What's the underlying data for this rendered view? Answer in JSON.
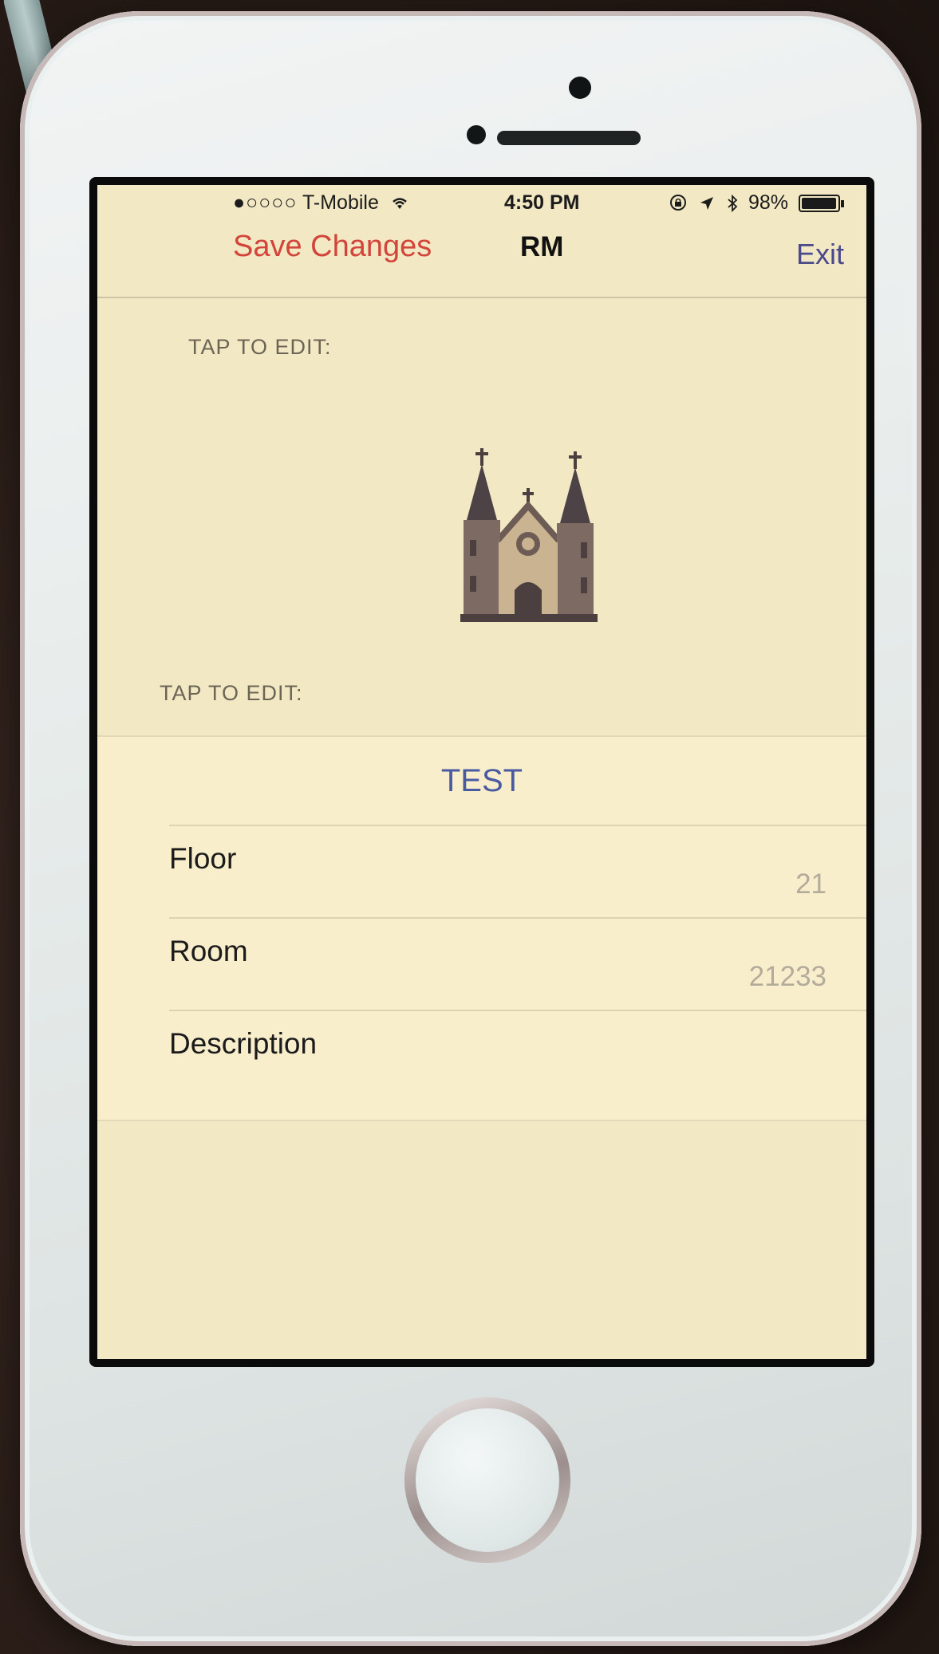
{
  "status_bar": {
    "signal": "●○○○○",
    "carrier": "T-Mobile",
    "time": "4:50 PM",
    "battery": "98%"
  },
  "nav": {
    "save_label": "Save Changes",
    "title": "RM",
    "exit_label": "Exit"
  },
  "image_section": {
    "label": "TAP TO EDIT:",
    "icon": "church-icon"
  },
  "details_section": {
    "label": "TAP TO EDIT:",
    "name": "TEST",
    "rows": [
      {
        "label": "Floor",
        "value": "21"
      },
      {
        "label": "Room",
        "value": "21233"
      },
      {
        "label": "Description",
        "value": ""
      }
    ]
  },
  "colors": {
    "save_accent": "#d2453a",
    "link_accent": "#4a5aa0",
    "screen_background": "#f3e8c4"
  }
}
